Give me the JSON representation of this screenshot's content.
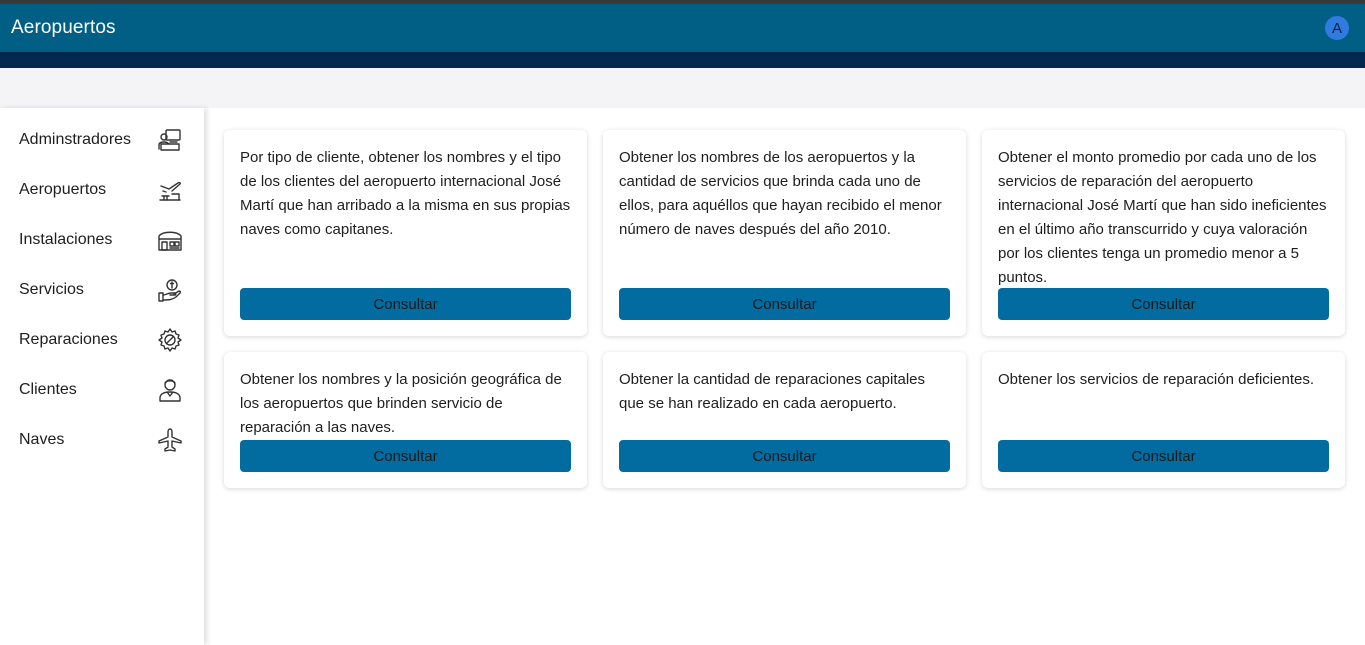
{
  "app": {
    "title": "Aeropuertos",
    "avatar_letter": "A"
  },
  "sidebar": {
    "items": [
      {
        "label": "Adminstradores",
        "icon": "admin-desk-icon"
      },
      {
        "label": "Aeropuertos",
        "icon": "airport-tower-icon"
      },
      {
        "label": "Instalaciones",
        "icon": "building-icon"
      },
      {
        "label": "Servicios",
        "icon": "hand-coin-icon"
      },
      {
        "label": "Reparaciones",
        "icon": "gear-wrench-icon"
      },
      {
        "label": "Clientes",
        "icon": "person-icon"
      },
      {
        "label": "Naves",
        "icon": "airplane-icon"
      }
    ]
  },
  "queries": [
    {
      "text": "Por tipo de cliente, obtener los nombres y el tipo de los clientes del aeropuerto internacional José Martí que han arribado a la misma en sus propias naves como capitanes.",
      "button": "Consultar"
    },
    {
      "text": "Obtener los nombres de los aeropuertos y la cantidad de servicios que brinda cada uno de ellos, para aquéllos que hayan recibido el menor número de naves después del año 2010.",
      "button": "Consultar"
    },
    {
      "text": "Obtener el monto promedio por cada uno de los servicios de reparación del aeropuerto internacional José Martí que han sido ineficientes en el último año transcurrido y cuya valoración por los clientes tenga un promedio menor a 5 puntos.",
      "button": "Consultar"
    },
    {
      "text": "Obtener los nombres y la posición geográfica de los aeropuertos que brinden servicio de reparación a las naves.",
      "button": "Consultar"
    },
    {
      "text": "Obtener la cantidad de reparaciones capitales que se han realizado en cada aeropuerto.",
      "button": "Consultar"
    },
    {
      "text": "Obtener los servicios de reparación deficientes.",
      "button": "Consultar"
    }
  ],
  "colors": {
    "app_bar": "#015e85",
    "sub_bar": "#02284d",
    "button": "#026ca1",
    "avatar": "#2f7be0"
  }
}
